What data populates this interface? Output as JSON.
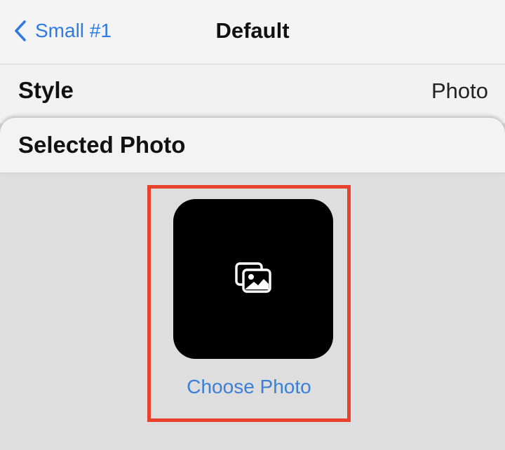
{
  "nav": {
    "back_label": "Small #1",
    "title": "Default"
  },
  "style_row": {
    "label": "Style",
    "value": "Photo"
  },
  "selected_photo": {
    "label": "Selected Photo",
    "choose_label": "Choose Photo"
  },
  "colors": {
    "accent": "#2f7be0",
    "highlight": "#e8412c",
    "tile": "#000000"
  },
  "icons": [
    "chevron-left-icon",
    "photos-icon"
  ]
}
